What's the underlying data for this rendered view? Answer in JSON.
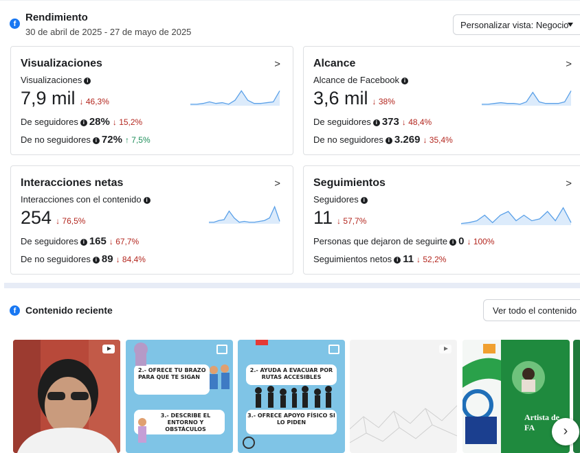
{
  "header": {
    "title": "Rendimiento",
    "date_range": "30 de abril de 2025 - 27 de mayo de 2025",
    "custom_view_label": "Personalizar vista: Negocio"
  },
  "cards": {
    "views": {
      "title": "Visualizaciones",
      "metric_label": "Visualizaciones",
      "value": "7,9 mil",
      "change": "↓ 46,3%",
      "row1_label": "De seguidores",
      "row1_value": "28%",
      "row1_change": "↓ 15,2%",
      "row2_label": "De no seguidores",
      "row2_value": "72%",
      "row2_change": "↑ 7,5%",
      "sparkline": [
        0.05,
        0.05,
        0.1,
        0.2,
        0.1,
        0.15,
        0.05,
        0.3,
        0.9,
        0.3,
        0.1,
        0.1,
        0.15,
        0.2,
        0.9
      ]
    },
    "reach": {
      "title": "Alcance",
      "metric_label": "Alcance de Facebook",
      "value": "3,6 mil",
      "change": "↓ 38%",
      "row1_label": "De seguidores",
      "row1_value": "373",
      "row1_change": "↓ 48,4%",
      "row2_label": "De no seguidores",
      "row2_value": "3.269",
      "row2_change": "↓ 35,4%",
      "sparkline": [
        0.05,
        0.05,
        0.1,
        0.15,
        0.1,
        0.1,
        0.05,
        0.2,
        0.8,
        0.2,
        0.1,
        0.1,
        0.1,
        0.2,
        0.9
      ]
    },
    "interactions": {
      "title": "Interacciones netas",
      "metric_label": "Interacciones con el contenido",
      "value": "254",
      "change": "↓ 76,5%",
      "row1_label": "De seguidores",
      "row1_value": "165",
      "row1_change": "↓ 67,7%",
      "row2_label": "De no seguidores",
      "row2_value": "89",
      "row2_change": "↓ 84,4%",
      "sparkline": [
        0.05,
        0.05,
        0.15,
        0.2,
        0.7,
        0.3,
        0.05,
        0.1,
        0.05,
        0.05,
        0.1,
        0.15,
        0.3,
        0.95,
        0.1
      ]
    },
    "follows": {
      "title": "Seguimientos",
      "metric_label": "Seguidores",
      "value": "11",
      "change": "↓ 57,7%",
      "row1_label": "Personas que dejaron de seguirte",
      "row1_value": "0",
      "row1_change": "↓ 100%",
      "row2_label": "Seguimientos netos",
      "row2_value": "11",
      "row2_change": "↓ 52,2%",
      "sparkline": [
        0.05,
        0.1,
        0.2,
        0.5,
        0.1,
        0.5,
        0.7,
        0.2,
        0.5,
        0.2,
        0.3,
        0.7,
        0.2,
        0.9,
        0.1
      ]
    }
  },
  "recent": {
    "title": "Contenido reciente",
    "see_all_label": "Ver todo el contenido",
    "post2_top": "2.- OFRECE TU BRAZO PARA QUE TE SIGAN",
    "post2_bottom": "3.- DESCRIBE EL ENTORNO Y OBSTÁCULOS",
    "post3_top": "2.- AYUDA A EVACUAR POR RUTAS ACCESIBLES",
    "post3_bottom": "3.- OFRECE APOYO FÍSICO SI LO PIDEN",
    "post5_text": "Artista de FA"
  },
  "colors": {
    "brand": "#1877f2",
    "down": "#b3261e",
    "up": "#1e8e5a",
    "sparkline": "#5aa0e8"
  }
}
